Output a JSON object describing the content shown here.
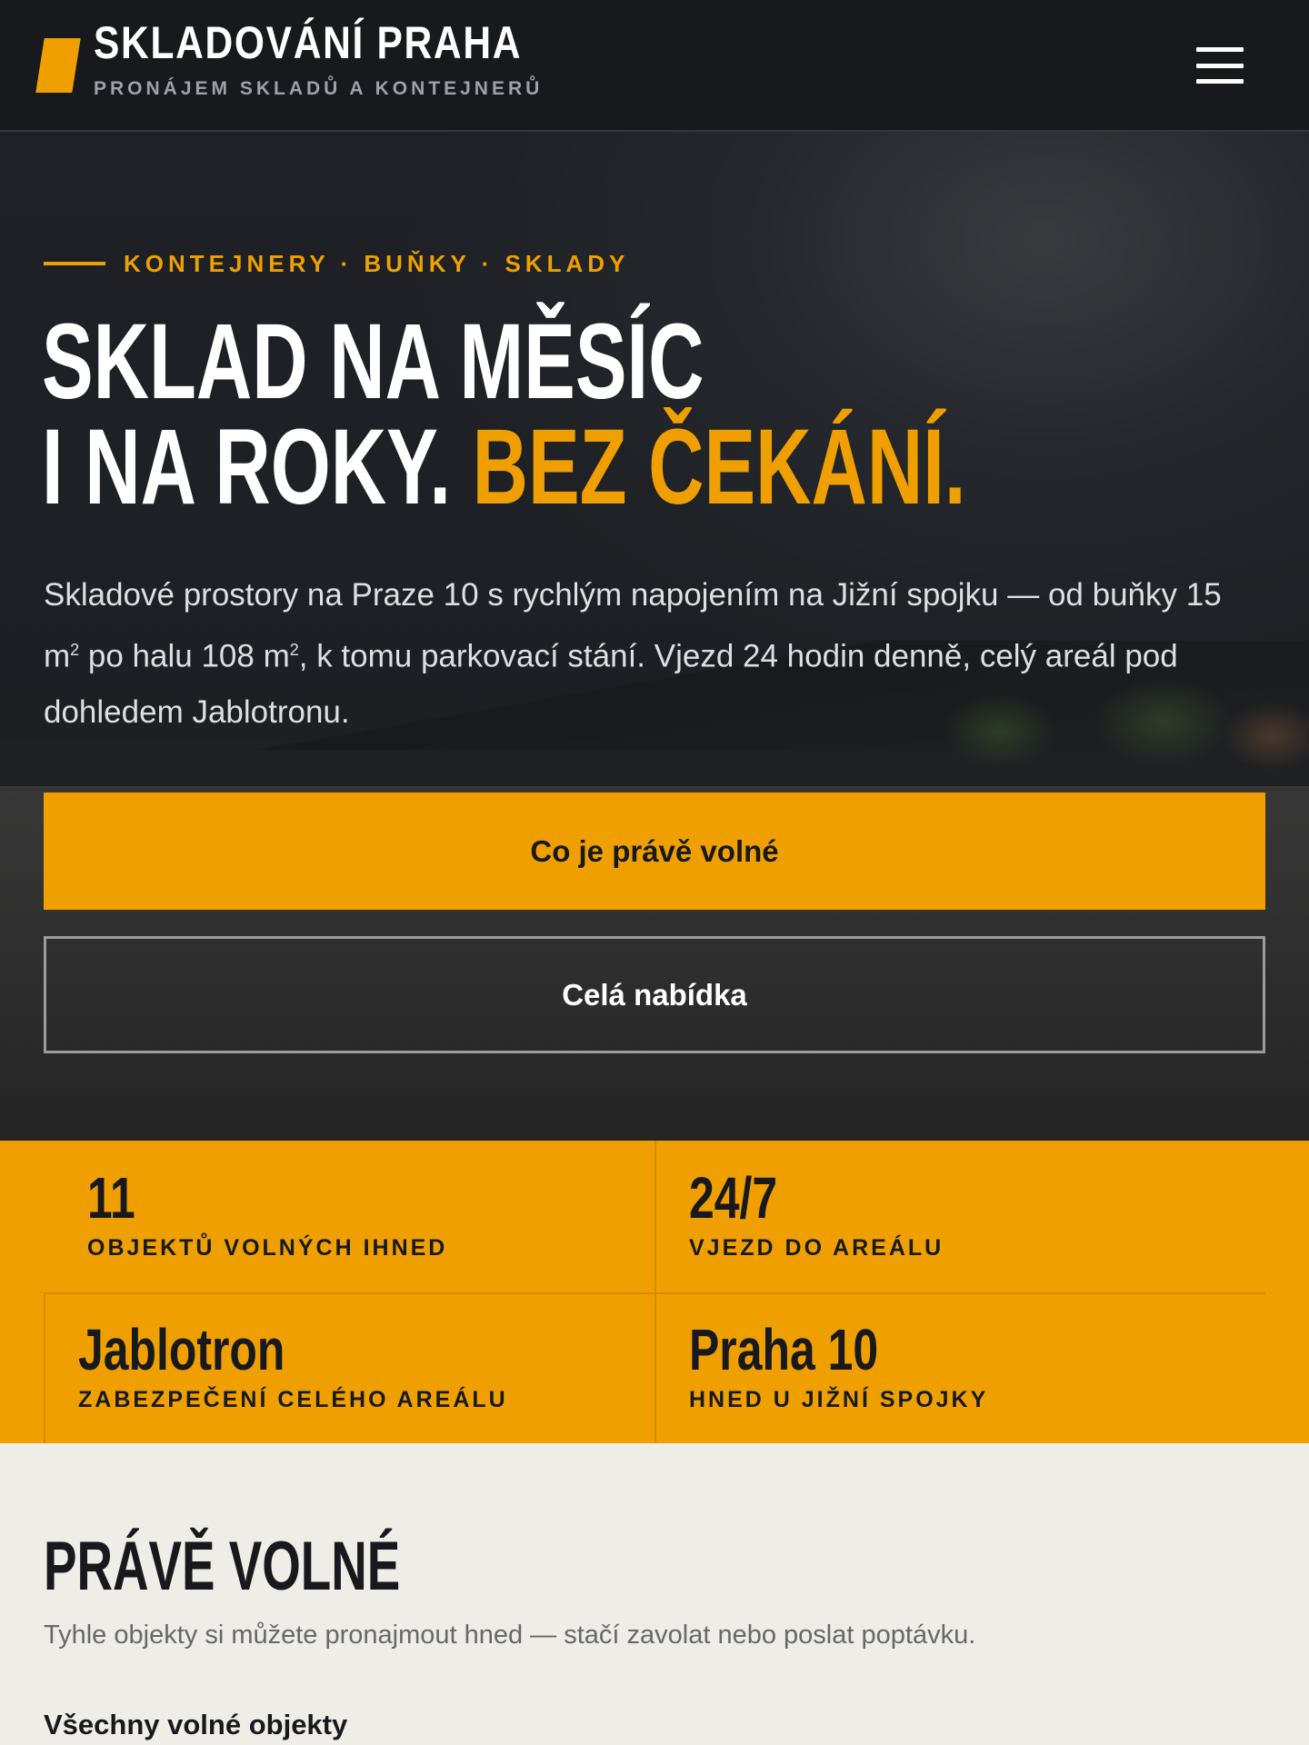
{
  "header": {
    "brand_title": "SKLADOVÁNÍ PRAHA",
    "brand_subtitle": "PRONÁJEM SKLADŮ A KONTEJNERŮ",
    "menu_icon": "hamburger-menu-icon"
  },
  "hero": {
    "eyebrow": "KONTEJNERY · BUŇKY · SKLADY",
    "headline_line1": "SKLAD NA MĚSÍC",
    "headline_line2_white": "I NA ROKY.",
    "headline_line2_accent": "BEZ ČEKÁNÍ.",
    "desc_part1": "Skladové prostory na Praze 10 s rychlým napojením na Jižní spojku — od buňky 15 m",
    "desc_sup1": "2",
    "desc_part2": " po halu 108 m",
    "desc_sup2": "2",
    "desc_part3": ", k tomu parkovací stání. Vjezd 24 hodin denně, celý areál pod dohledem Jablotronu.",
    "primary_button": "Co je právě volné",
    "secondary_button": "Celá nabídka"
  },
  "stats": [
    {
      "value": "11",
      "label": "OBJEKTŮ VOLNÝCH IHNED"
    },
    {
      "value": "24/7",
      "label": "VJEZD DO AREÁLU"
    },
    {
      "value": "Jablotron",
      "label": "ZABEZPEČENÍ CELÉHO AREÁLU"
    },
    {
      "value": "Praha 10",
      "label": "HNED U JIŽNÍ SPOJKY"
    }
  ],
  "available_section": {
    "title": "PRÁVĚ VOLNÉ",
    "subtitle": "Tyhle objekty si můžete pronajmout hned — stačí zavolat nebo poslat poptávku.",
    "all_link": "Všechny volné objekty"
  },
  "colors": {
    "accent": "#efa000",
    "dark": "#17191d",
    "page_bg": "#eeede7"
  }
}
